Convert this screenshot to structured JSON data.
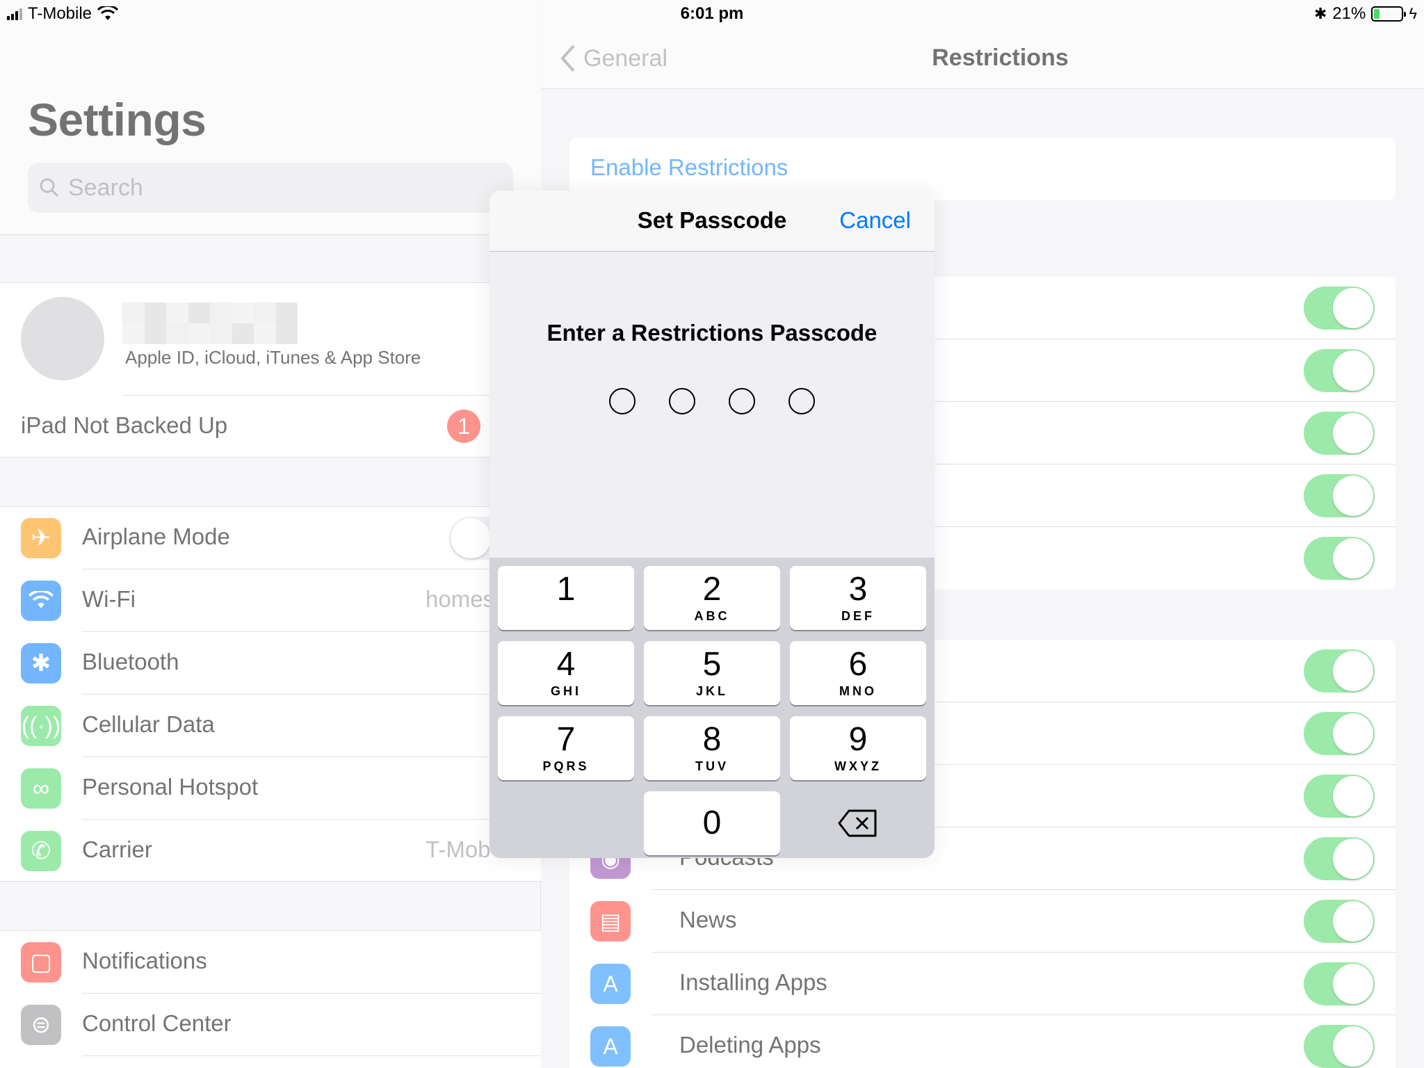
{
  "status": {
    "carrier": "T-Mobile",
    "time": "6:01 pm",
    "battery": "21%",
    "battery_level": 0.21
  },
  "left": {
    "title": "Settings",
    "search_placeholder": "Search",
    "profile_subtitle": "Apple ID, iCloud, iTunes & App Store",
    "backup_label": "iPad Not Backed Up",
    "backup_badge": "1",
    "items": [
      {
        "label": "Airplane Mode",
        "value": "",
        "icon": "airplane-icon",
        "color": "#ff9500"
      },
      {
        "label": "Wi-Fi",
        "value": "homes",
        "icon": "wifi-icon",
        "color": "#007aff"
      },
      {
        "label": "Bluetooth",
        "value": "",
        "icon": "bluetooth-icon",
        "color": "#007aff"
      },
      {
        "label": "Cellular Data",
        "value": "",
        "icon": "antenna-icon",
        "color": "#4cd964"
      },
      {
        "label": "Personal Hotspot",
        "value": "",
        "icon": "hotspot-icon",
        "color": "#4cd964"
      },
      {
        "label": "Carrier",
        "value": "T-Mob",
        "icon": "phone-icon",
        "color": "#4cd964"
      }
    ],
    "items2": [
      {
        "label": "Notifications",
        "icon": "notifications-icon",
        "color": "#ff3b30"
      },
      {
        "label": "Control Center",
        "icon": "control-center-icon",
        "color": "#8e8e93"
      }
    ]
  },
  "right": {
    "back_label": "General",
    "title": "Restrictions",
    "enable_label": "Enable Restrictions",
    "partial_label": "Podcasts",
    "rows": [
      {
        "label": "News",
        "icon": "news-icon",
        "color": "#ff3b30"
      },
      {
        "label": "Installing Apps",
        "icon": "app-store-icon",
        "color": "#1a8cff"
      },
      {
        "label": "Deleting Apps",
        "icon": "app-store-icon",
        "color": "#1a8cff"
      }
    ]
  },
  "modal": {
    "title": "Set Passcode",
    "cancel": "Cancel",
    "prompt": "Enter a Restrictions Passcode",
    "keys": [
      {
        "num": "1",
        "letters": ""
      },
      {
        "num": "2",
        "letters": "ABC"
      },
      {
        "num": "3",
        "letters": "DEF"
      },
      {
        "num": "4",
        "letters": "GHI"
      },
      {
        "num": "5",
        "letters": "JKL"
      },
      {
        "num": "6",
        "letters": "MNO"
      },
      {
        "num": "7",
        "letters": "PQRS"
      },
      {
        "num": "8",
        "letters": "TUV"
      },
      {
        "num": "9",
        "letters": "WXYZ"
      },
      {
        "num": "0",
        "letters": ""
      }
    ]
  }
}
